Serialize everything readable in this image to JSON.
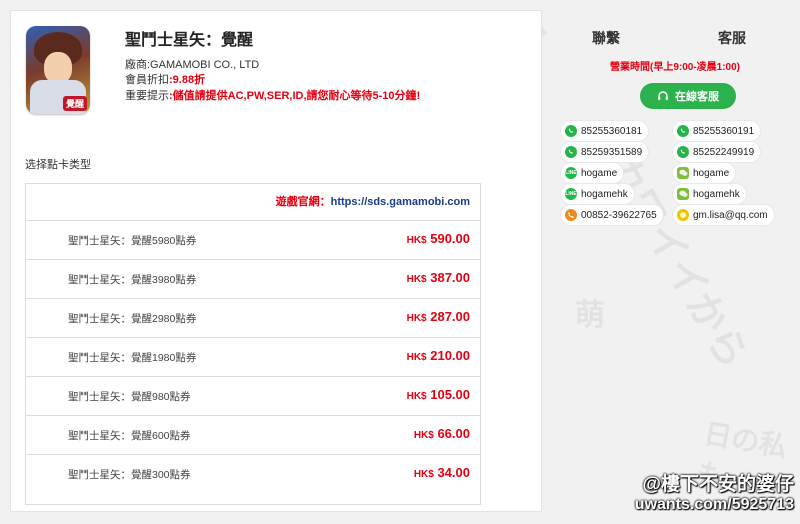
{
  "game": {
    "title": "聖鬥士星矢：覺醒",
    "icon_stamp": "覺醒",
    "vendor_label": "廠商",
    "vendor": ":GAMAMOBI CO., LTD",
    "discount_label": "會員折扣",
    "discount": ":9.88折",
    "notice_label": "重要提示",
    "notice": ":儲值請提供AC,PW,SER,ID,請您耐心等待5-10分鐘!"
  },
  "section_label": "选择點卡类型",
  "official_site": {
    "label": "遊戲官網：",
    "url": "https://sds.gamamobi.com"
  },
  "cards": [
    {
      "name": "聖鬥士星矢：覺醒5980點券",
      "currency": "HK$",
      "price": "590.00"
    },
    {
      "name": "聖鬥士星矢：覺醒3980點券",
      "currency": "HK$",
      "price": "387.00"
    },
    {
      "name": "聖鬥士星矢：覺醒2980點券",
      "currency": "HK$",
      "price": "287.00"
    },
    {
      "name": "聖鬥士星矢：覺醒1980點券",
      "currency": "HK$",
      "price": "210.00"
    },
    {
      "name": "聖鬥士星矢：覺醒980點券",
      "currency": "HK$",
      "price": "105.00"
    },
    {
      "name": "聖鬥士星矢：覺醒600點券",
      "currency": "HK$",
      "price": "66.00"
    },
    {
      "name": "聖鬥士星矢：覺醒300點券",
      "currency": "HK$",
      "price": "34.00"
    }
  ],
  "contact": {
    "tab_contact": "聯繫",
    "tab_service": "客服",
    "hours": "營業時間(早上9:00-凌晨1:00)",
    "chat_button": "在線客服",
    "items": [
      {
        "icon": "whatsapp-icon",
        "text": "85255360181"
      },
      {
        "icon": "whatsapp-icon",
        "text": "85255360191"
      },
      {
        "icon": "whatsapp-icon",
        "text": "85259351589"
      },
      {
        "icon": "whatsapp-icon",
        "text": "85252249919"
      },
      {
        "icon": "line-icon",
        "text": "hogame"
      },
      {
        "icon": "wechat-icon",
        "text": "hogame"
      },
      {
        "icon": "line-icon",
        "text": "hogamehk"
      },
      {
        "icon": "wechat-icon",
        "text": "hogamehk"
      },
      {
        "icon": "phone-icon",
        "text": "00852-39622765"
      },
      {
        "icon": "email-icon",
        "text": "gm.lisa@qq.com"
      }
    ]
  },
  "watermark": {
    "line1": "@樓下不安的婆仔",
    "line2": "uwants.com/5925713"
  },
  "colors": {
    "accent_red": "#e60012",
    "button_green": "#2bb24c",
    "link_blue": "#1a3b8b"
  }
}
